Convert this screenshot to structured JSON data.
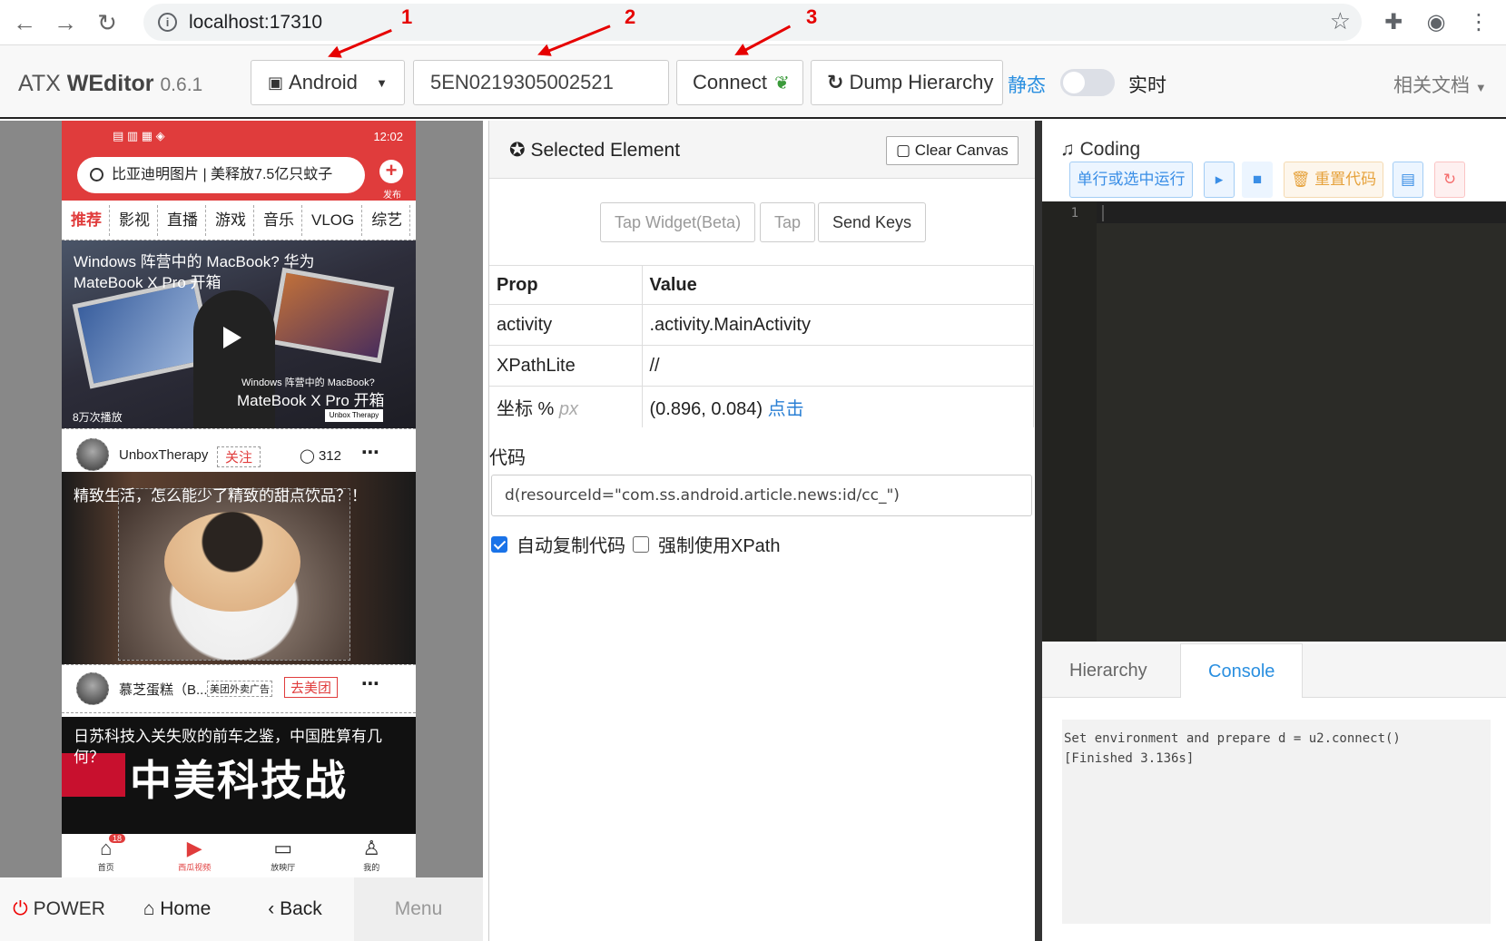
{
  "browser": {
    "url": "localhost:17310"
  },
  "navbar": {
    "brand_prefix": "ATX",
    "brand_main": "WEditor",
    "version": "0.6.1",
    "platform": "Android",
    "serial": "5EN0219305002521",
    "connect_label": "Connect",
    "dump_label": "Dump Hierarchy",
    "mode_static": "静态",
    "mode_live": "实时",
    "docs_label": "相关文档",
    "annotations": [
      "1",
      "2",
      "3"
    ]
  },
  "phone": {
    "status_time": "12:02",
    "search_text": "比亚迪明图片 | 美释放7.5亿只蚊子",
    "post_label": "发布",
    "tabs": [
      "推荐",
      "影视",
      "直播",
      "游戏",
      "音乐",
      "VLOG",
      "综艺"
    ],
    "card1": {
      "title": "Windows 阵营中的 MacBook? 华为 MateBook X Pro 开箱",
      "overlay_small": "Windows 阵营中的 MacBook?",
      "overlay_big": "MateBook X Pro 开箱",
      "views": "8万次播放",
      "logo_text": "Unbox Therapy",
      "author": "UnboxTherapy",
      "follow": "关注",
      "comments": "312"
    },
    "card2": {
      "title": "精致生活，怎么能少了精致的甜点饮品？！",
      "author": "慕芝蛋糕（B...",
      "ad_tag": "美团外卖广告",
      "cta": "去美团"
    },
    "card3": {
      "title": "日苏科技入关失败的前车之鉴，中国胜算有几何？",
      "big_text": "中美科技战"
    },
    "bottom_nav": [
      "首页",
      "西瓜视频",
      "放映厅",
      "我的"
    ],
    "badge": "18"
  },
  "controls": {
    "power": "POWER",
    "home": "Home",
    "back": "Back",
    "menu": "Menu"
  },
  "inspector": {
    "title": "Selected Element",
    "clear_canvas": "Clear Canvas",
    "tap_widget": "Tap Widget(Beta)",
    "tap": "Tap",
    "send_keys": "Send Keys",
    "table_headers": [
      "Prop",
      "Value"
    ],
    "rows": [
      {
        "prop": "activity",
        "value": ".activity.MainActivity"
      },
      {
        "prop": "XPathLite",
        "value": "//"
      }
    ],
    "coord_label": "坐标 %",
    "coord_px": "px",
    "coord_value": "(0.896, 0.084)",
    "coord_link": "点击",
    "code_label": "代码",
    "code_value": "d(resourceId=\"com.ss.android.article.news:id/cc_\")",
    "auto_copy": "自动复制代码",
    "force_xpath": "强制使用XPath"
  },
  "coding": {
    "title": "Coding",
    "run_selected": "单行或选中运行",
    "reset_code": "重置代码",
    "line_number": "1",
    "tab_hierarchy": "Hierarchy",
    "tab_console": "Console",
    "console_output": "Set environment and prepare d = u2.connect()\n[Finished 3.136s]"
  }
}
